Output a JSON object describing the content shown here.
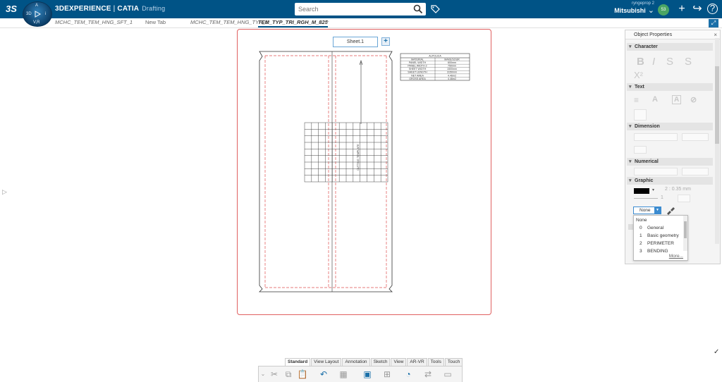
{
  "header": {
    "ds_logo": "3S",
    "compass": {
      "top": "A",
      "left": "3D",
      "right": "i",
      "bottom": "V,R"
    },
    "brand_bold": "3DEXPERIENCE",
    "brand_sep": " | ",
    "brand_catia": "CATIA",
    "app_name": "Drafting",
    "search_placeholder": "Search",
    "user_small": "ryngeprop 2",
    "user_name": "Mitsubishi",
    "user_chevron": "⌄",
    "badge": "53",
    "add_icon": "+",
    "share_icon": "↪",
    "help_icon": "?"
  },
  "tabs": [
    {
      "label": "MCHC_TEM_TEM_HNG_SFT_1"
    },
    {
      "label": "New Tab"
    },
    {
      "label": "MCHC_TEM_TEM_HNG_TYP_1"
    },
    {
      "label": "TEM_TYP_TRI_RGH_M_825"
    }
  ],
  "tab_add": "+",
  "corner_btn": "⤢",
  "sheet": {
    "label": "Sheet.1",
    "add": "+"
  },
  "title_block": {
    "header": "ALPOLICA",
    "rows": [
      [
        "MATERIAL",
        "MAKE/SOUR"
      ],
      [
        "PANEL WIDTH",
        "600mm"
      ],
      [
        "PANEL WIDTH 2",
        "750mm"
      ],
      [
        "SHEET WIDTH",
        "1500mm"
      ],
      [
        "SHEET LENGTH",
        "3150mm"
      ],
      [
        "NET AREA",
        "4.46m2"
      ],
      [
        "GROSS AREA",
        "4.46m2"
      ]
    ]
  },
  "drawing_note": "CUTTING TEMPLATE",
  "side_arrow": "▷",
  "properties": {
    "title": "Object Properties",
    "close": "×",
    "sections": {
      "character": "Character",
      "text": "Text",
      "dimension": "Dimension",
      "numerical": "Numerical",
      "graphic": "Graphic"
    },
    "char_buttons": {
      "bold": "B",
      "italic": "I",
      "strike": "S",
      "underline": "S",
      "superscript": "X²"
    },
    "line_thickness": "2 : 0.35 mm",
    "line_type": "1",
    "layer_value": "None",
    "layer_options": [
      {
        "num": "",
        "label": "None"
      },
      {
        "num": "0",
        "label": "General"
      },
      {
        "num": "1",
        "label": "Basic geometry"
      },
      {
        "num": "2",
        "label": "PERIMETER"
      },
      {
        "num": "3",
        "label": "BENDING"
      }
    ],
    "more_label": "More..."
  },
  "ribbon_tabs": [
    "Standard",
    "View Layout",
    "Annotation",
    "Sketch",
    "View",
    "AR-VR",
    "Tools",
    "Touch"
  ],
  "toolbar_icons": [
    "chevron-icon",
    "cut-icon",
    "copy-icon",
    "paste-icon",
    "undo-icon",
    "print-icon",
    "view-icon",
    "layout-icon",
    "measure-icon",
    "scale-icon",
    "frame-icon"
  ],
  "checkmark": "✓",
  "colors": {
    "brand": "#005386",
    "accent": "#1a6fa8",
    "sheet_border": "#e06060",
    "dash": "#e05050"
  }
}
